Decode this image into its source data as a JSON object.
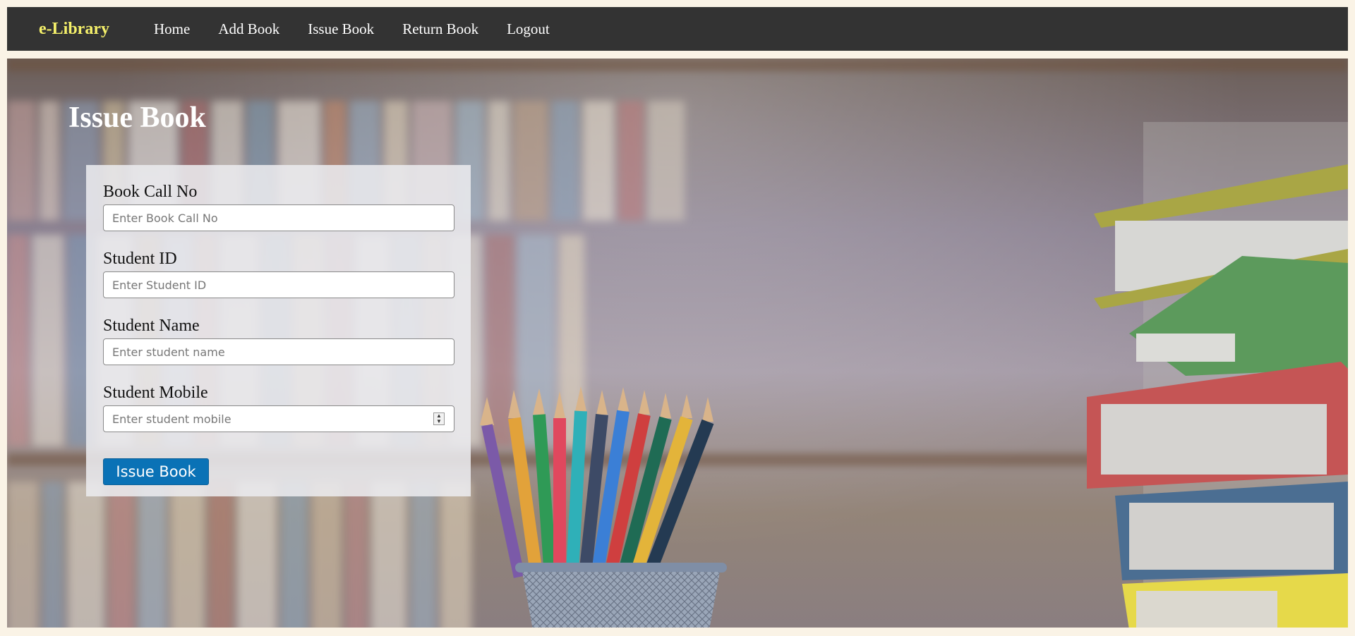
{
  "navbar": {
    "brand": "e-Library",
    "links": [
      "Home",
      "Add Book",
      "Issue Book",
      "Return Book",
      "Logout"
    ]
  },
  "page": {
    "title": "Issue Book"
  },
  "form": {
    "fields": [
      {
        "label": "Book Call No",
        "placeholder": "Enter Book Call No"
      },
      {
        "label": "Student ID",
        "placeholder": "Enter Student ID"
      },
      {
        "label": "Student Name",
        "placeholder": "Enter student name"
      },
      {
        "label": "Student Mobile",
        "placeholder": "Enter student mobile"
      }
    ],
    "submit_label": "Issue Book"
  },
  "colors": {
    "navbar_bg": "#333333",
    "brand": "#f5f06a",
    "button": "#0a72b6",
    "page_bg": "#faf3e6"
  }
}
